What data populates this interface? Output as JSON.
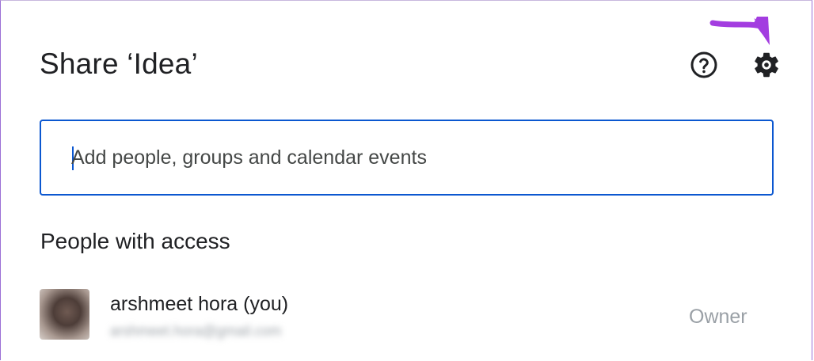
{
  "dialog": {
    "title": "Share ‘Idea’",
    "help_icon": "help-circle-icon",
    "settings_icon": "gear-icon",
    "annotation_color": "#a33de0"
  },
  "search": {
    "placeholder": "Add people, groups and calendar events",
    "value": "",
    "border_color": "#0b57d0"
  },
  "access": {
    "heading": "People with access",
    "people": [
      {
        "name": "arshmeet hora (you)",
        "email": "arshmeet.hora@gmail.com",
        "role": "Owner"
      }
    ]
  }
}
